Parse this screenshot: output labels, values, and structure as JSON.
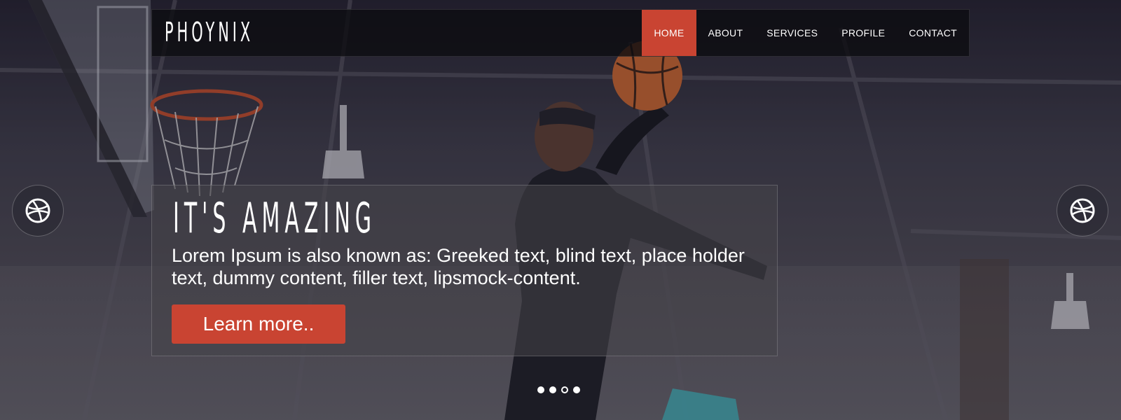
{
  "brand": {
    "logo_text": "PHOYNIX"
  },
  "nav": {
    "items": [
      {
        "label": "HOME",
        "active": true
      },
      {
        "label": "ABOUT",
        "active": false
      },
      {
        "label": "SERVICES",
        "active": false
      },
      {
        "label": "PROFILE",
        "active": false
      },
      {
        "label": "CONTACT",
        "active": false
      }
    ]
  },
  "hero": {
    "title": "IT'S AMAZING",
    "text": "Lorem Ipsum is also known as: Greeked text, blind text, place holder text, dummy content, filler text, lipsmock-content.",
    "button_label": "Learn more.."
  },
  "slider": {
    "prev_icon": "dribbble-icon",
    "next_icon": "dribbble-icon",
    "dots": [
      {
        "active": false
      },
      {
        "active": false
      },
      {
        "active": true
      },
      {
        "active": false
      }
    ]
  },
  "colors": {
    "accent": "#c94432",
    "nav_bg": "#0c0c10",
    "text": "#ffffff"
  }
}
